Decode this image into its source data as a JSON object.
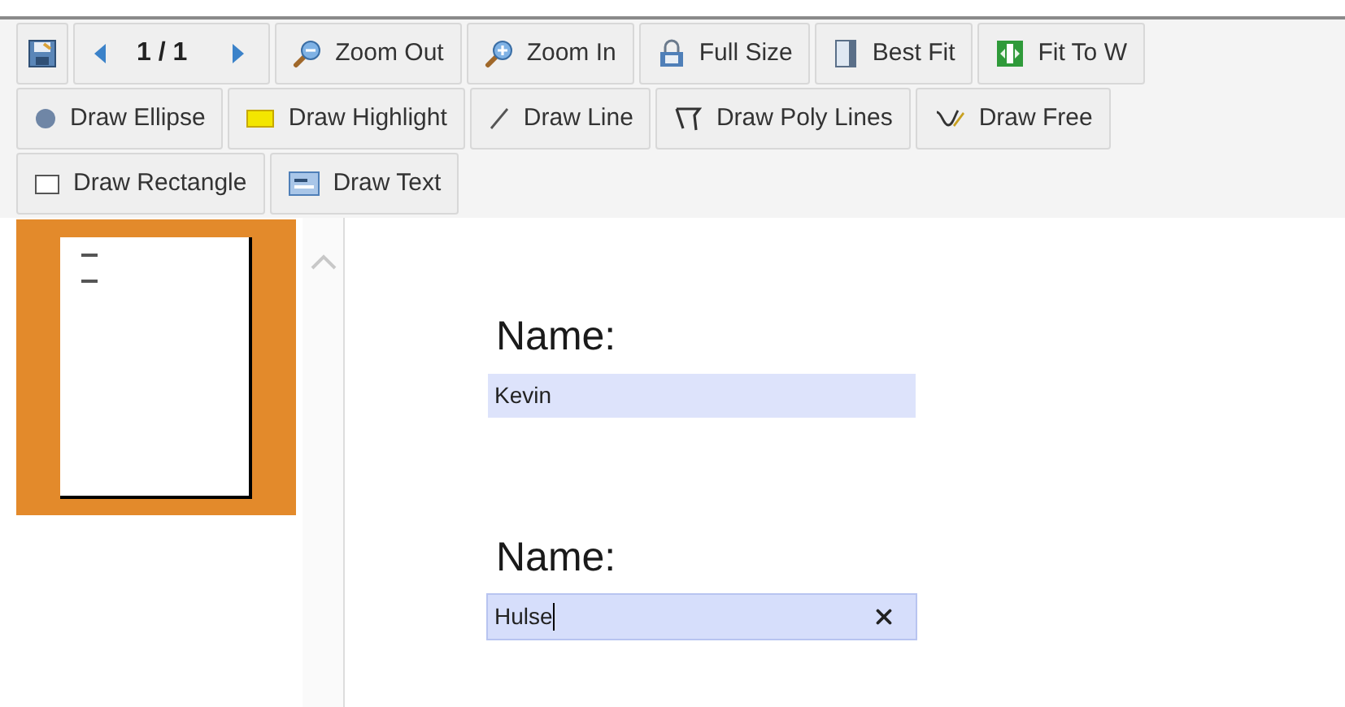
{
  "toolbar": {
    "view_tools": [
      {
        "kind": "save"
      },
      {
        "kind": "pager",
        "page": "1 / 1"
      },
      {
        "kind": "zoom-out",
        "label": "Zoom Out"
      },
      {
        "kind": "zoom-in",
        "label": "Zoom In"
      },
      {
        "kind": "full-size",
        "label": "Full Size"
      },
      {
        "kind": "best-fit",
        "label": "Best Fit"
      },
      {
        "kind": "fit-width",
        "label": "Fit To W"
      }
    ],
    "drawing_tools": [
      {
        "kind": "ellipse",
        "label": "Draw Ellipse"
      },
      {
        "kind": "highlight",
        "label": "Draw Highlight"
      },
      {
        "kind": "line",
        "label": "Draw Line"
      },
      {
        "kind": "poly",
        "label": "Draw Poly Lines"
      },
      {
        "kind": "free",
        "label": "Draw Free"
      },
      {
        "kind": "rectangle",
        "label": "Draw Rectangle"
      },
      {
        "kind": "text",
        "label": "Draw Text"
      }
    ]
  },
  "thumbnails": [
    {
      "selected": true
    }
  ],
  "form": {
    "fields": [
      {
        "label": "Name:",
        "value": "Kevin",
        "focused": false
      },
      {
        "label": "Name:",
        "value": "Hulse",
        "focused": true
      }
    ]
  }
}
